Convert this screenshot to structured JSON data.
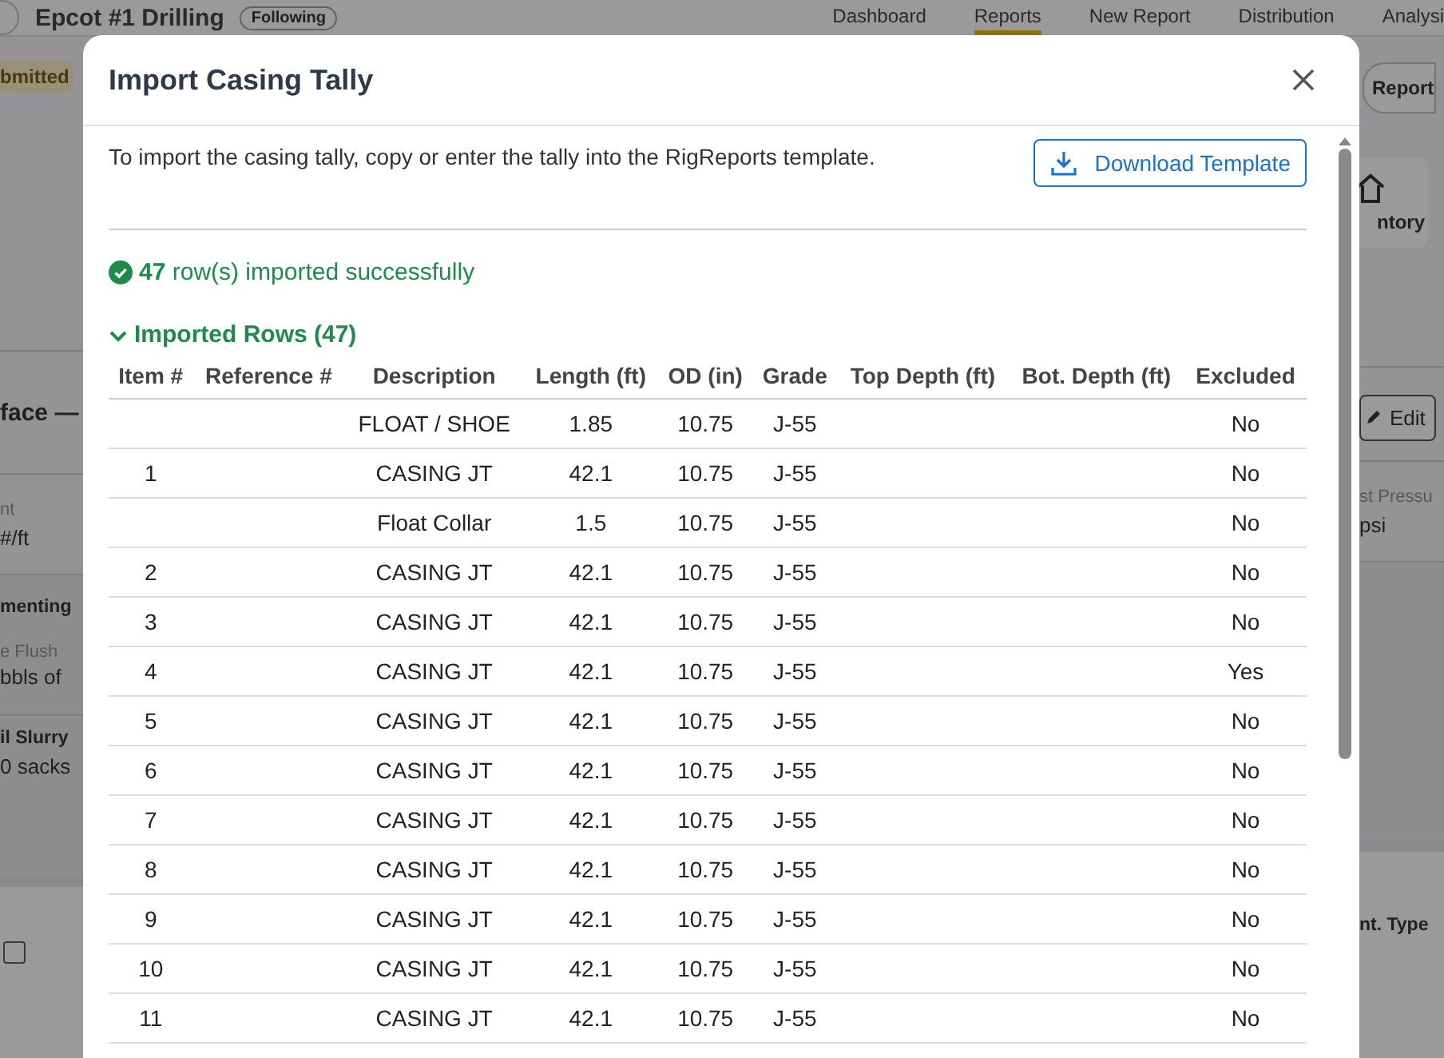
{
  "page": {
    "title": "Epcot #1 Drilling",
    "follow_badge": "Following",
    "nav": [
      {
        "label": "Dashboard",
        "selected": false
      },
      {
        "label": "Reports",
        "selected": true
      },
      {
        "label": "New Report",
        "selected": false
      },
      {
        "label": "Distribution",
        "selected": false
      },
      {
        "label": "Analysi",
        "selected": false
      }
    ],
    "status_badge": "bmitted",
    "report_button": "Report",
    "inventory_card": "ntory",
    "section_title": "face —",
    "edit_button": "Edit",
    "left_fields": [
      {
        "label": "nt",
        "value": "#/ft"
      }
    ],
    "right_fields": [
      {
        "label": "st Pressu",
        "value": "psi"
      }
    ],
    "cementing": {
      "title": "menting",
      "flush_label": "e Flush",
      "flush_value": "bbls of",
      "slurry_title": "il Slurry",
      "slurry_value": "0 sacks"
    },
    "lower_table": {
      "checkbox_checked": false,
      "column_end": "nt. Type"
    }
  },
  "dialog": {
    "title": "Import Casing Tally",
    "intro": "To import the casing tally, copy or enter the tally into the RigReports template.",
    "download_button": "Download Template",
    "success": "**47** row(s) imported successfully",
    "section": {
      "label": "Imported Rows (47)",
      "expanded": true
    },
    "table": {
      "columns": [
        "Item #",
        "Reference #",
        "Description",
        "Length (ft)",
        "OD (in)",
        "Grade",
        "Top Depth (ft)",
        "Bot. Depth (ft)",
        "Excluded"
      ],
      "rows": [
        [
          "",
          "",
          "FLOAT / SHOE",
          "1.85",
          "10.75",
          "J-55",
          "",
          "",
          "No"
        ],
        [
          "1",
          "",
          "CASING JT",
          "42.1",
          "10.75",
          "J-55",
          "",
          "",
          "No"
        ],
        [
          "",
          "",
          "Float Collar",
          "1.5",
          "10.75",
          "J-55",
          "",
          "",
          "No"
        ],
        [
          "2",
          "",
          "CASING JT",
          "42.1",
          "10.75",
          "J-55",
          "",
          "",
          "No"
        ],
        [
          "3",
          "",
          "CASING JT",
          "42.1",
          "10.75",
          "J-55",
          "",
          "",
          "No"
        ],
        [
          "4",
          "",
          "CASING JT",
          "42.1",
          "10.75",
          "J-55",
          "",
          "",
          "Yes"
        ],
        [
          "5",
          "",
          "CASING JT",
          "42.1",
          "10.75",
          "J-55",
          "",
          "",
          "No"
        ],
        [
          "6",
          "",
          "CASING JT",
          "42.1",
          "10.75",
          "J-55",
          "",
          "",
          "No"
        ],
        [
          "7",
          "",
          "CASING JT",
          "42.1",
          "10.75",
          "J-55",
          "",
          "",
          "No"
        ],
        [
          "8",
          "",
          "CASING JT",
          "42.1",
          "10.75",
          "J-55",
          "",
          "",
          "No"
        ],
        [
          "9",
          "",
          "CASING JT",
          "42.1",
          "10.75",
          "J-55",
          "",
          "",
          "No"
        ],
        [
          "10",
          "",
          "CASING JT",
          "42.1",
          "10.75",
          "J-55",
          "",
          "",
          "No"
        ],
        [
          "11",
          "",
          "CASING JT",
          "42.1",
          "10.75",
          "J-55",
          "",
          "",
          "No"
        ]
      ]
    }
  }
}
